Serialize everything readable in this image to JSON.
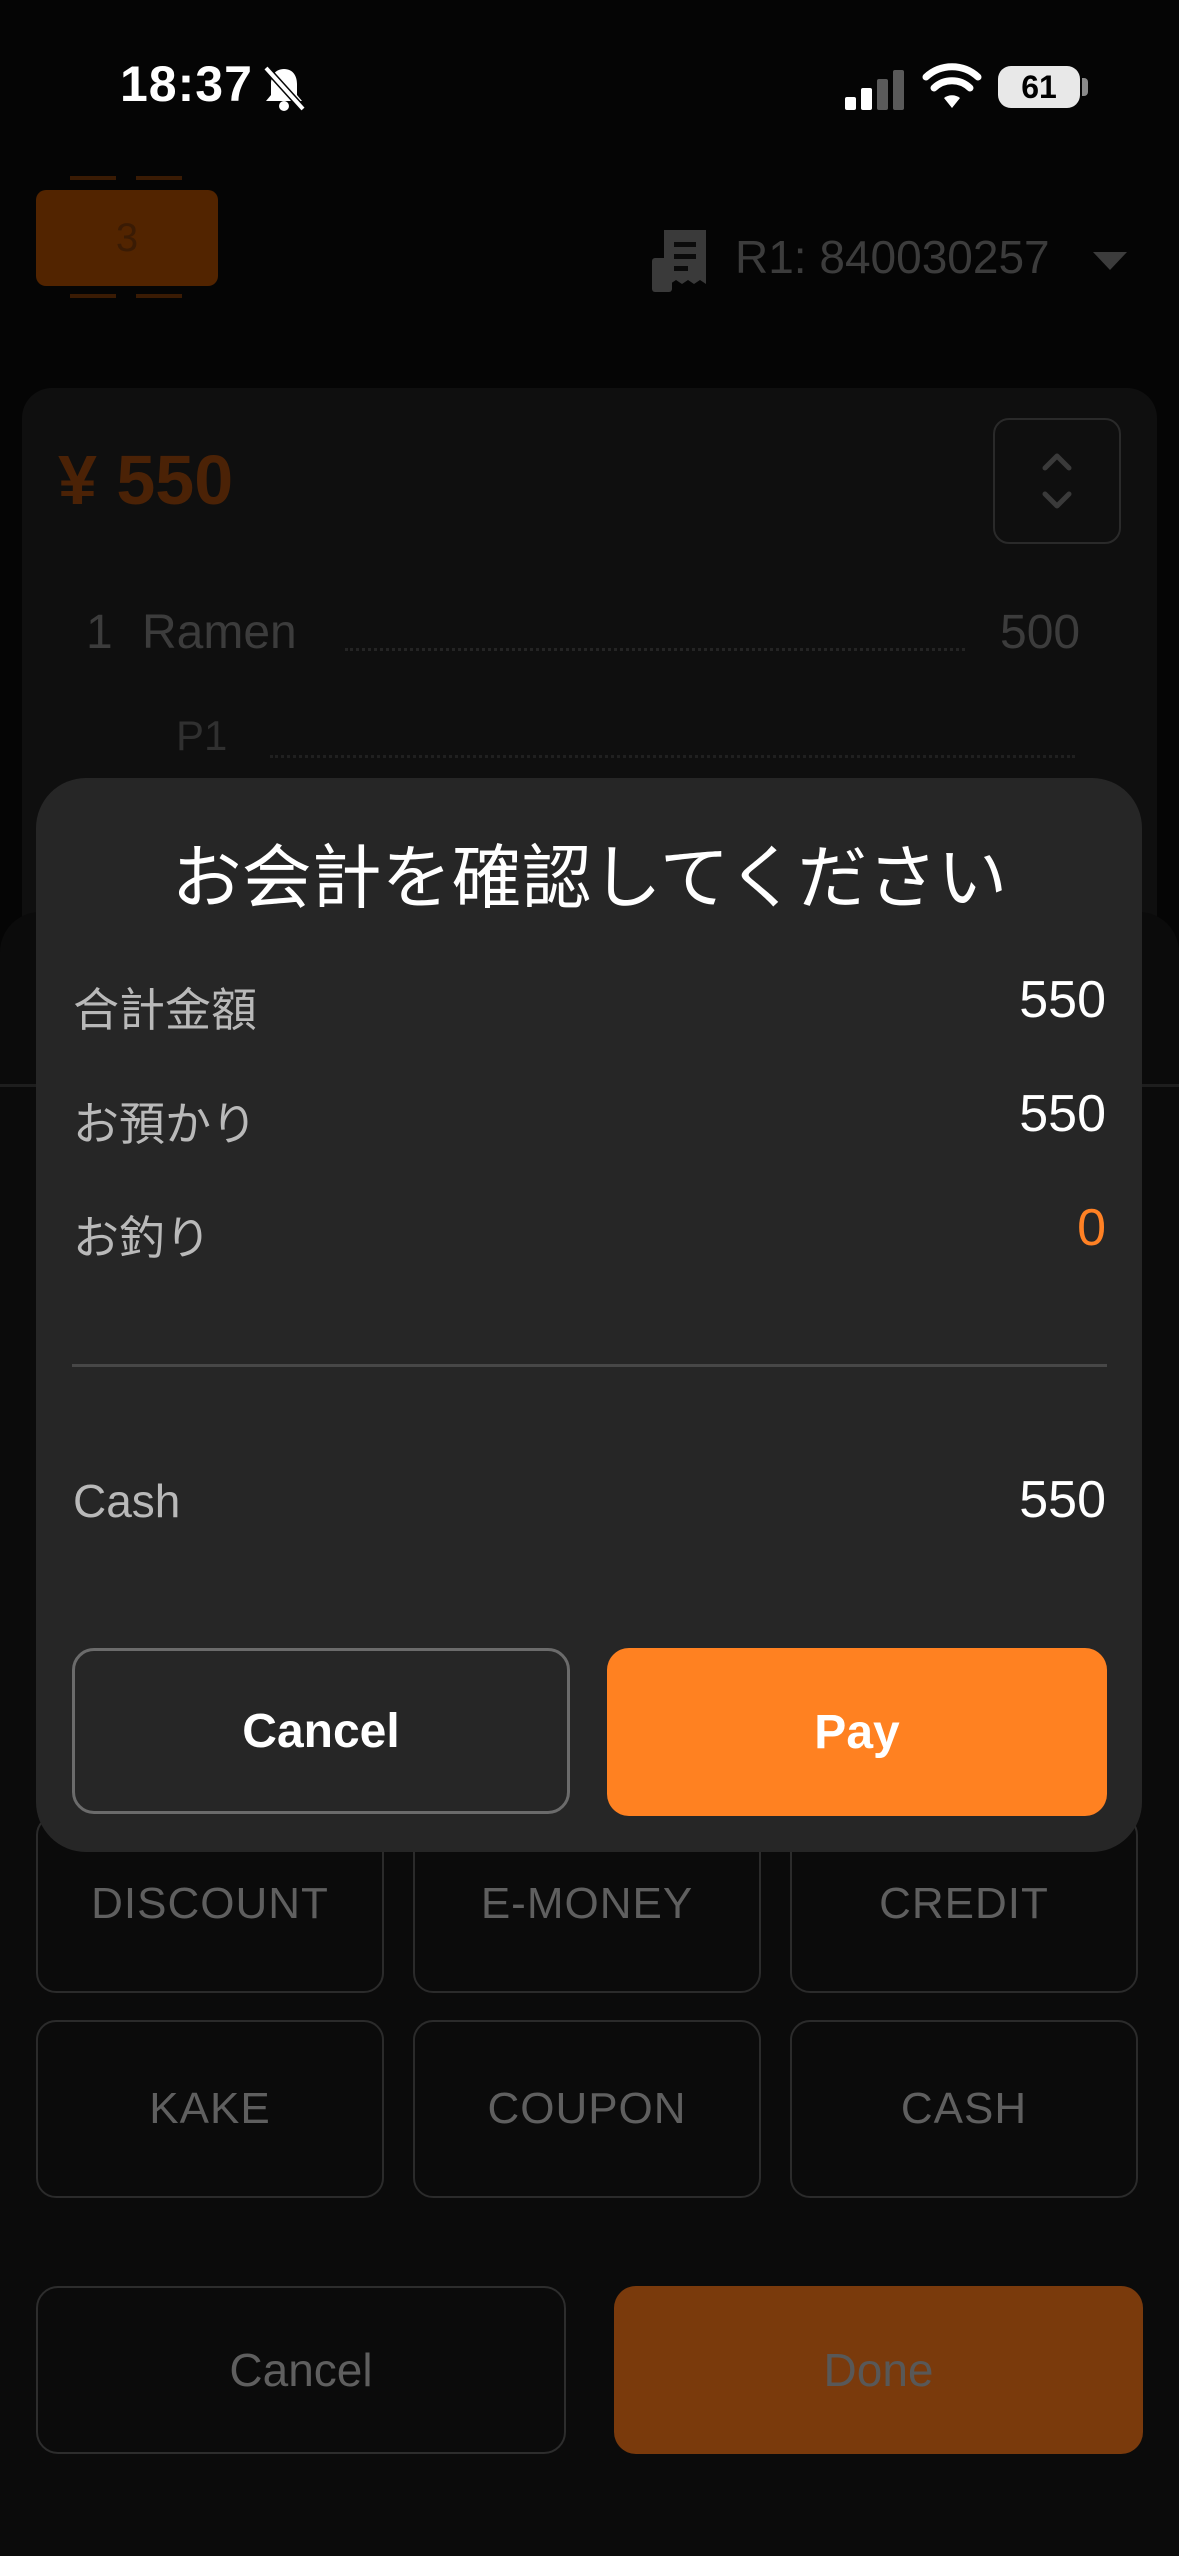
{
  "status_bar": {
    "time": "18:37",
    "battery": "61"
  },
  "header": {
    "order_number": "3",
    "register_label": "R1: 840030257"
  },
  "order": {
    "total": "¥ 550",
    "items": [
      {
        "qty": "1",
        "name": "Ramen",
        "price": "500"
      }
    ],
    "sub_row": "P1"
  },
  "payment_methods": [
    "DISCOUNT",
    "E-MONEY",
    "CREDIT",
    "KAKE",
    "COUPON",
    "CASH"
  ],
  "footer": {
    "cancel_label": "Cancel",
    "done_label": "Done"
  },
  "modal": {
    "title": "お会計を確認してください",
    "rows": [
      {
        "label": "合計金額",
        "value": "550"
      },
      {
        "label": "お預かり",
        "value": "550"
      },
      {
        "label": "お釣り",
        "value": "0"
      }
    ],
    "method": {
      "label": "Cash",
      "value": "550"
    },
    "cancel_label": "Cancel",
    "pay_label": "Pay"
  },
  "colors": {
    "accent": "#ff8121",
    "modal_bg": "#262626",
    "background": "#050505"
  }
}
